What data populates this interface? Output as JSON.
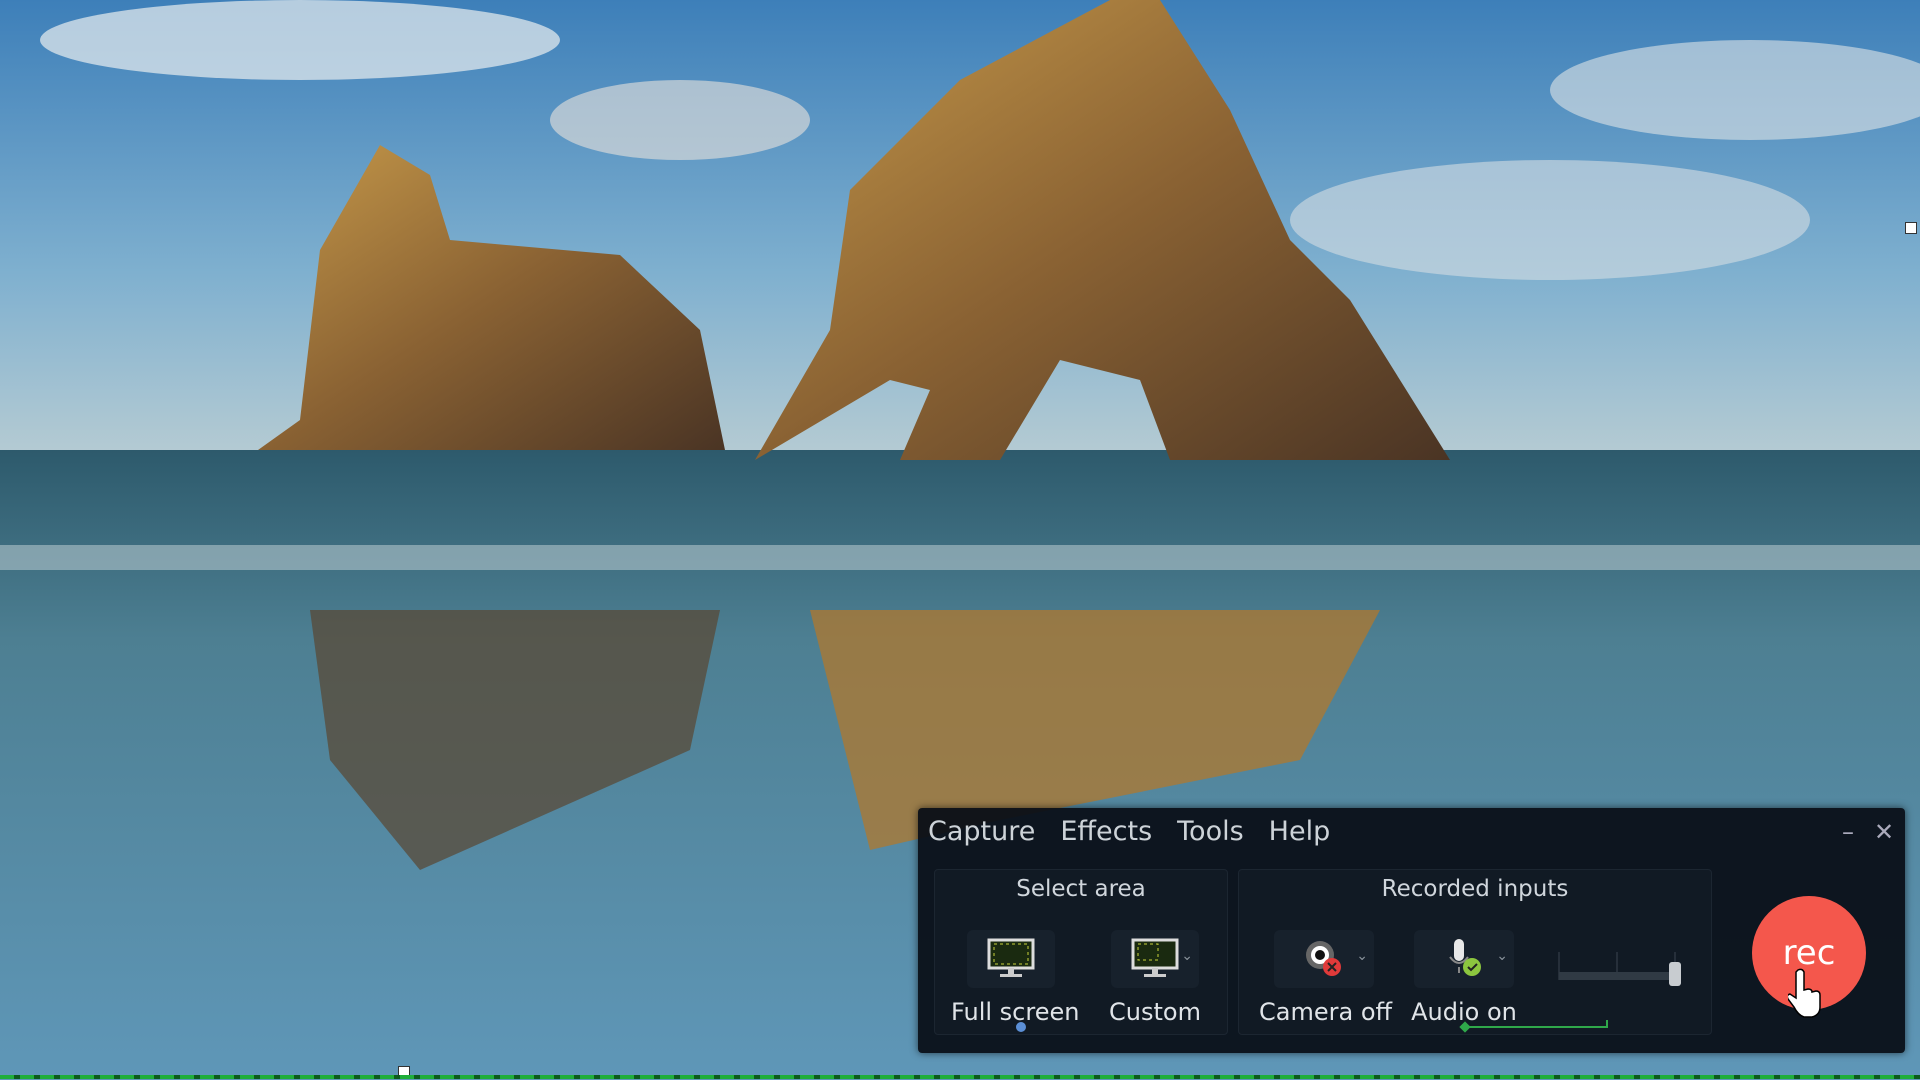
{
  "menu": {
    "items": [
      "Capture",
      "Effects",
      "Tools",
      "Help"
    ]
  },
  "window": {
    "minimize": "–",
    "close": "✕"
  },
  "select_area": {
    "title": "Select area",
    "full_screen": "Full screen",
    "custom": "Custom",
    "selected": "Full screen"
  },
  "recorded_inputs": {
    "title": "Recorded inputs",
    "camera": "Camera off",
    "audio": "Audio on",
    "camera_enabled": false,
    "audio_enabled": true,
    "volume_level": 1.0
  },
  "rec_button": {
    "label": "rec",
    "color": "#f4574c"
  },
  "colors": {
    "panel": "#080e16",
    "accent_blue": "#5b8fd6",
    "accent_green": "#2fa84a",
    "camera_off": "#e03a3a",
    "audio_on": "#8cc63f"
  }
}
